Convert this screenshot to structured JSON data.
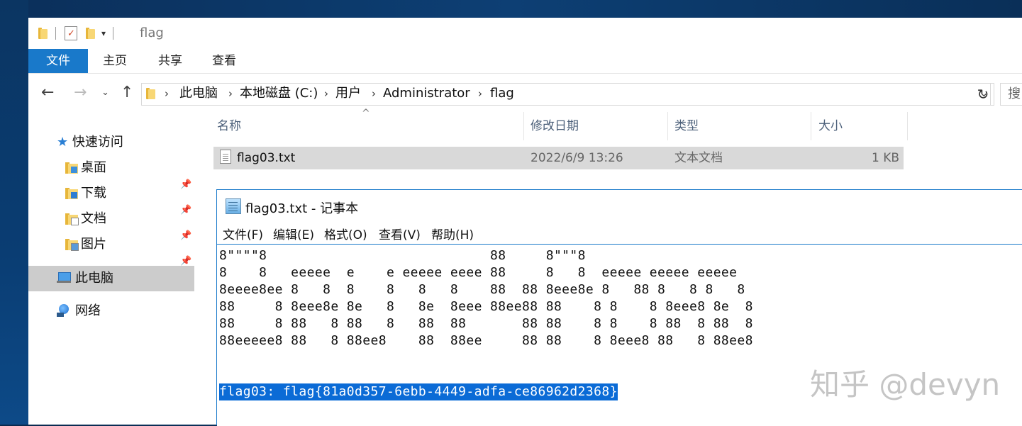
{
  "window": {
    "title": "flag"
  },
  "ribbon": {
    "tabs": [
      "文件",
      "主页",
      "共享",
      "查看"
    ]
  },
  "address": {
    "crumbs": [
      "此电脑",
      "本地磁盘 (C:)",
      "用户",
      "Administrator",
      "flag"
    ],
    "search_placeholder": "搜"
  },
  "nav": {
    "quick_access": "快速访问",
    "items": [
      "桌面",
      "下载",
      "文档",
      "图片"
    ],
    "this_pc": "此电脑",
    "network": "网络"
  },
  "columns": {
    "name": "名称",
    "date": "修改日期",
    "type": "类型",
    "size": "大小"
  },
  "files": [
    {
      "name": "flag03.txt",
      "date": "2022/6/9 13:26",
      "type": "文本文档",
      "size": "1 KB"
    }
  ],
  "notepad": {
    "title": "flag03.txt - 记事本",
    "menu": [
      "文件(F)",
      "编辑(E)",
      "格式(O)",
      "查看(V)",
      "帮助(H)"
    ],
    "lines": [
      "8\"\"\"\"8                            88     8\"\"\"8",
      "8    8   eeeee  e    e eeeee eeee 88     8   8  eeeee eeeee eeeee",
      "8eeee8ee 8   8  8    8   8   8    88  88 8eee8e 8   88 8   8 8   8",
      "88     8 8eee8e 8e   8   8e  8eee 88ee88 88    8 8    8 8eee8 8e  8",
      "88     8 88   8 88   8   88  88       88 88    8 8    8 88  8 88  8",
      "88eeeee8 88   8 88ee8    88  88ee     88 88    8 8eee8 88   8 88ee8"
    ],
    "flag_line": "flag03: flag{81a0d357-6ebb-4449-adfa-ce86962d2368}"
  },
  "watermark": "知乎 @devyn",
  "colors": {
    "accent": "#1979ca",
    "selection": "#0b6bd6"
  }
}
